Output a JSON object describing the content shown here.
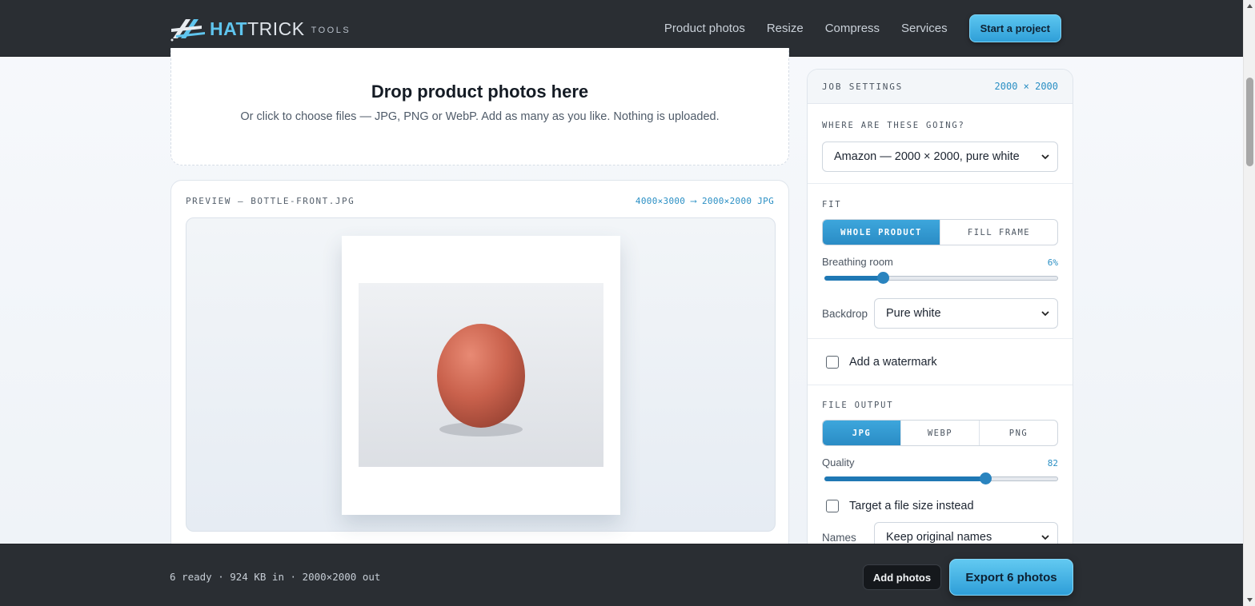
{
  "brand": {
    "hat": "HAT",
    "trick": "TRICK",
    "tools": "TOOLS",
    "accent": "#5fc5ee"
  },
  "nav": {
    "items": [
      {
        "label": "Product photos"
      },
      {
        "label": "Resize"
      },
      {
        "label": "Compress"
      },
      {
        "label": "Services"
      }
    ],
    "cta": "Start a project"
  },
  "dropzone": {
    "title": "Drop product photos here",
    "subtitle": "Or click to choose files — JPG, PNG or WebP. Add as many as you like. Nothing is uploaded."
  },
  "preview": {
    "label": "PREVIEW — BOTTLE-FRONT.JPG",
    "dims": "4000×3000 ⟶ 2000×2000 JPG"
  },
  "settings": {
    "title": "JOB SETTINGS",
    "size": "2000 × 2000",
    "destination": {
      "label": "WHERE ARE THESE GOING?",
      "value": "Amazon — 2000 × 2000, pure white"
    },
    "fit": {
      "label": "FIT",
      "options": [
        {
          "label": "WHOLE PRODUCT",
          "active": true
        },
        {
          "label": "FILL FRAME",
          "active": false
        }
      ],
      "breathing_label": "Breathing room",
      "breathing_value": "6%",
      "breathing_fraction": 0.25
    },
    "backdrop": {
      "label": "Backdrop",
      "value": "Pure white"
    },
    "watermark": {
      "label": "Add a watermark",
      "checked": false
    },
    "output": {
      "label": "FILE OUTPUT",
      "formats": [
        {
          "label": "JPG",
          "active": true
        },
        {
          "label": "WEBP",
          "active": false
        },
        {
          "label": "PNG",
          "active": false
        }
      ],
      "quality_label": "Quality",
      "quality_value": "82",
      "quality_fraction": 0.69,
      "target_label": "Target a file size instead",
      "names_label": "Names",
      "names_value": "Keep original names"
    }
  },
  "bottom": {
    "status": "6 ready · 924 KB in · 2000×2000 out",
    "add_button": "Add photos",
    "export_button": "Export 6 photos"
  }
}
